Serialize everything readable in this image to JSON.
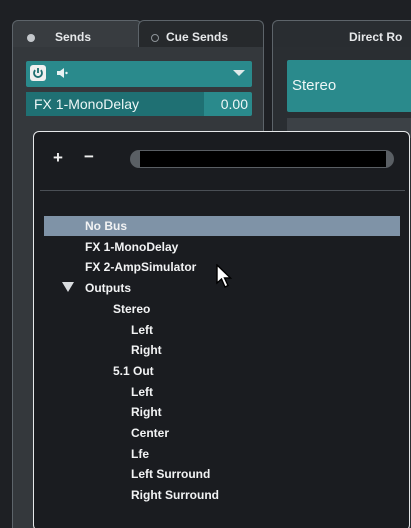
{
  "tabs": [
    {
      "label": "Sends",
      "active": true,
      "dot_color": "#bfc3c7"
    },
    {
      "label": "Cue Sends",
      "active": false
    },
    {
      "label": "Direct Ro",
      "active": false
    }
  ],
  "send_slot": {
    "power_icon": "power-icon",
    "speaker_icon": "speaker-icon",
    "name": "FX 1-MonoDelay",
    "level": "0.00",
    "accent_color": "#2a8a8c"
  },
  "direct_routing": {
    "selected": "Stereo"
  },
  "popup": {
    "add_label": "+",
    "remove_label": "−",
    "search_value": "",
    "items": [
      {
        "label": "No Bus",
        "indent": 0,
        "selected": true
      },
      {
        "label": "FX 1-MonoDelay",
        "indent": 0
      },
      {
        "label": "FX 2-AmpSimulator",
        "indent": 0
      },
      {
        "label": "Outputs",
        "indent": 0,
        "expanded": true,
        "has_toggle": true
      },
      {
        "label": "Stereo",
        "indent": 1
      },
      {
        "label": "Left",
        "indent": 2
      },
      {
        "label": "Right",
        "indent": 2
      },
      {
        "label": "5.1 Out",
        "indent": 1
      },
      {
        "label": "Left",
        "indent": 2
      },
      {
        "label": "Right",
        "indent": 2
      },
      {
        "label": "Center",
        "indent": 2
      },
      {
        "label": "Lfe",
        "indent": 2
      },
      {
        "label": "Left Surround",
        "indent": 2
      },
      {
        "label": "Right Surround",
        "indent": 2
      }
    ]
  }
}
